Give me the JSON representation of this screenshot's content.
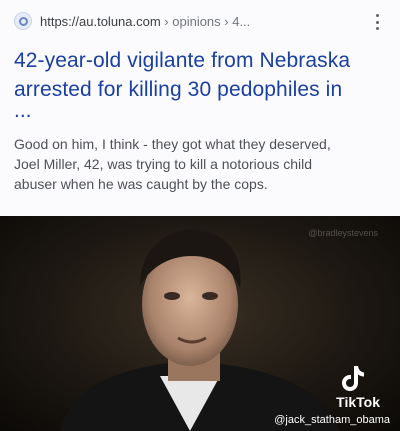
{
  "result": {
    "url_domain": "https://au.toluna.com",
    "url_path": " › opinions › 4...",
    "headline_line1": "42-year-old vigilante from Nebraska",
    "headline_line2": "arrested for killing 30 pedophiles in",
    "headline_ellipsis": "...",
    "snippet_line1": "Good on him, I think - they got what they deserved,",
    "snippet_line2": "Joel Miller, 42, was trying to kill a notorious child",
    "snippet_line3": "abuser when he was caught by the cops.",
    "favicon_icon": "globe-icon",
    "more_icon": "more-vert-icon",
    "headline_color": "#1a3fa3"
  },
  "video": {
    "watermark_top": "@bradleystevens",
    "brand": "TikTok",
    "username": "@jack_statham_obama",
    "logo_icon": "tiktok-logo-icon"
  }
}
